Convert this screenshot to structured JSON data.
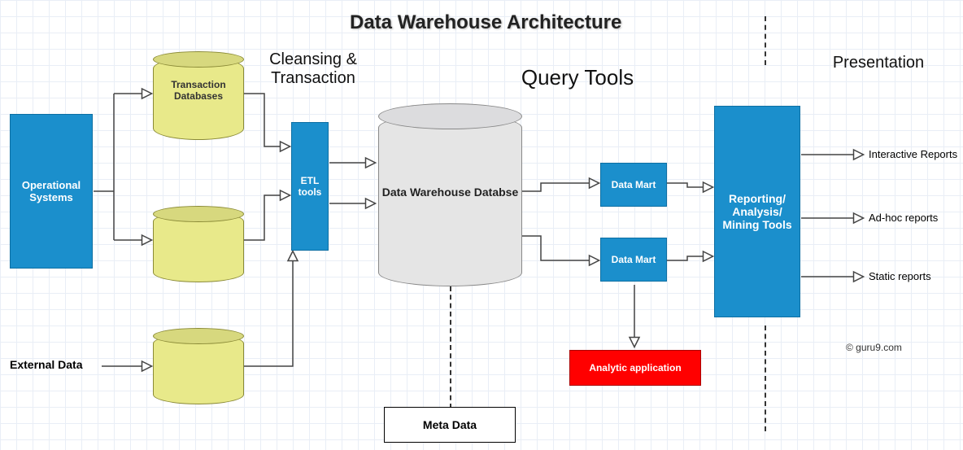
{
  "title": "Data Warehouse Architecture",
  "sections": {
    "cleansing": "Cleansing & Transaction",
    "query_tools": "Query Tools",
    "presentation": "Presentation"
  },
  "nodes": {
    "operational_systems": "Operational Systems",
    "transaction_db": "Transaction Databases",
    "external_data_label": "External Data",
    "etl_tools": "ETL tools",
    "dw_db": "Data Warehouse Databse",
    "data_mart_1": "Data Mart",
    "data_mart_2": "Data Mart",
    "reporting": "Reporting/ Analysis/ Mining Tools",
    "analytic_app": "Analytic application",
    "meta_data": "Meta Data"
  },
  "outputs": {
    "interactive": "Interactive Reports",
    "adhoc": "Ad-hoc reports",
    "static": "Static reports"
  },
  "credit": "© guru9.com"
}
